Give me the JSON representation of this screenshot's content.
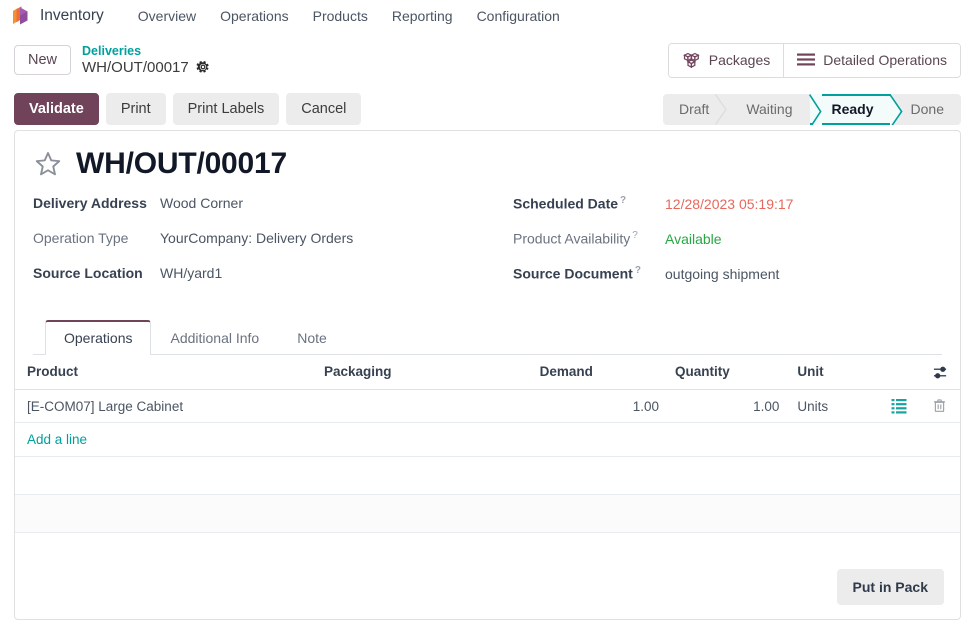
{
  "navbar": {
    "app_icon": "inventory-cube-icon",
    "app_name": "Inventory",
    "menu_items": [
      {
        "label": "Overview"
      },
      {
        "label": "Operations"
      },
      {
        "label": "Products"
      },
      {
        "label": "Reporting"
      },
      {
        "label": "Configuration"
      }
    ]
  },
  "control_panel": {
    "new_label": "New",
    "breadcrumb_parent": "Deliveries",
    "breadcrumb_current": "WH/OUT/00017",
    "gear_icon": "gear-icon",
    "buttons": [
      {
        "label": "Packages",
        "icon": "packages-icon"
      },
      {
        "label": "Detailed Operations",
        "icon": "list-lines-icon"
      }
    ]
  },
  "actions": {
    "validate_label": "Validate",
    "print_label": "Print",
    "print_labels_label": "Print Labels",
    "cancel_label": "Cancel"
  },
  "pipeline": {
    "stages": [
      {
        "label": "Draft",
        "active": false
      },
      {
        "label": "Waiting",
        "active": false
      },
      {
        "label": "Ready",
        "active": true
      },
      {
        "label": "Done",
        "active": false
      }
    ]
  },
  "record": {
    "star_icon": "star-outline-icon",
    "title": "WH/OUT/00017",
    "left_fields": [
      {
        "label": "Delivery Address",
        "value": "Wood Corner",
        "required": true,
        "tooltip": false
      },
      {
        "label": "Operation Type",
        "value": "YourCompany: Delivery Orders",
        "required": false,
        "tooltip": false
      },
      {
        "label": "Source Location",
        "value": "WH/yard1",
        "required": true,
        "tooltip": false
      }
    ],
    "right_fields": [
      {
        "label": "Scheduled Date",
        "value": "12/28/2023 05:19:17",
        "required": true,
        "tooltip": true,
        "style": "danger"
      },
      {
        "label": "Product Availability",
        "value": "Available",
        "required": false,
        "tooltip": true,
        "style": "success"
      },
      {
        "label": "Source Document",
        "value": "outgoing shipment",
        "required": true,
        "tooltip": true,
        "style": ""
      }
    ]
  },
  "notebook": {
    "tabs": [
      {
        "label": "Operations",
        "active": true
      },
      {
        "label": "Additional Info",
        "active": false
      },
      {
        "label": "Note",
        "active": false
      }
    ]
  },
  "table": {
    "columns": [
      "Product",
      "Packaging",
      "Demand",
      "Quantity",
      "Unit"
    ],
    "optional_columns_icon": "sliders-icon",
    "rows": [
      {
        "product": "[E-COM07] Large Cabinet",
        "packaging": "",
        "demand": "1.00",
        "quantity": "1.00",
        "unit": "Units",
        "detail_icon": "detailed-operations-icon",
        "delete_icon": "trash-icon"
      }
    ],
    "add_line_label": "Add a line"
  },
  "footer": {
    "put_in_pack_label": "Put in Pack"
  },
  "colors": {
    "brand_purple": "#71435b",
    "teal": "#00a09d",
    "danger": "#e6685d",
    "success": "#28a745"
  }
}
